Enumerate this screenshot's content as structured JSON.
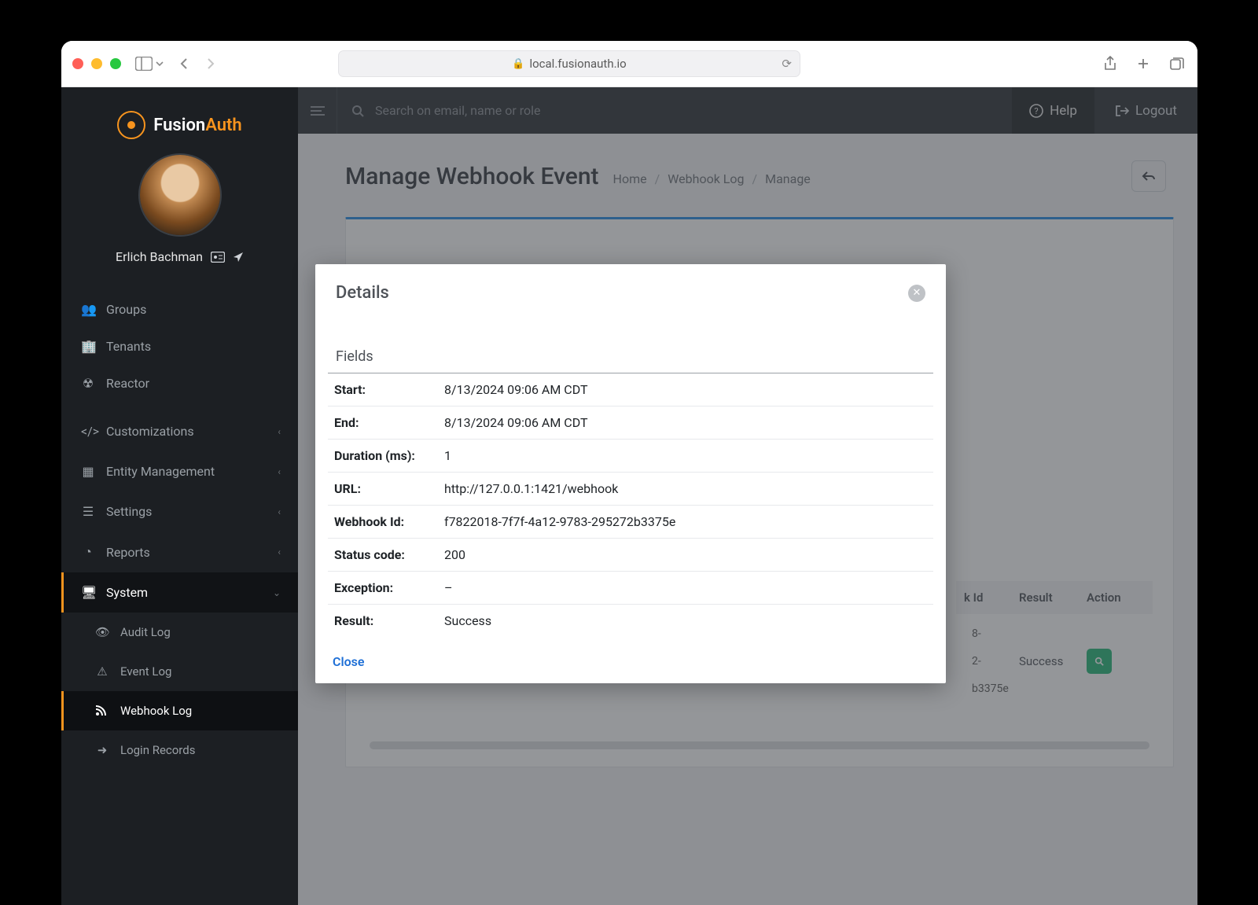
{
  "browser": {
    "url": "local.fusionauth.io"
  },
  "brand": {
    "text_a": "Fusion",
    "text_b": "Auth"
  },
  "user": {
    "name": "Erlich Bachman"
  },
  "sidebar": {
    "items": [
      {
        "label": "Groups"
      },
      {
        "label": "Tenants"
      },
      {
        "label": "Reactor"
      },
      {
        "label": "Customizations"
      },
      {
        "label": "Entity Management"
      },
      {
        "label": "Settings"
      },
      {
        "label": "Reports"
      },
      {
        "label": "System"
      },
      {
        "label": "Audit Log"
      },
      {
        "label": "Event Log"
      },
      {
        "label": "Webhook Log"
      },
      {
        "label": "Login Records"
      }
    ]
  },
  "topbar": {
    "search_placeholder": "Search on email, name or role",
    "help": "Help",
    "logout": "Logout"
  },
  "page": {
    "title": "Manage Webhook Event",
    "crumbs": [
      "Home",
      "Webhook Log",
      "Manage"
    ]
  },
  "table": {
    "headers": {
      "id": "k Id",
      "result": "Result",
      "action": "Action"
    },
    "row": {
      "id_lines": [
        "8-",
        "2-",
        "b3375e"
      ],
      "result": "Success"
    }
  },
  "modal": {
    "title": "Details",
    "section": "Fields",
    "fields": [
      {
        "label": "Start:",
        "value": "8/13/2024 09:06 AM CDT"
      },
      {
        "label": "End:",
        "value": "8/13/2024 09:06 AM CDT"
      },
      {
        "label": "Duration (ms):",
        "value": "1"
      },
      {
        "label": "URL:",
        "value": "http://127.0.0.1:1421/webhook"
      },
      {
        "label": "Webhook Id:",
        "value": "f7822018-7f7f-4a12-9783-295272b3375e"
      },
      {
        "label": "Status code:",
        "value": "200"
      },
      {
        "label": "Exception:",
        "value": "–"
      },
      {
        "label": "Result:",
        "value": "Success"
      }
    ],
    "close": "Close"
  }
}
